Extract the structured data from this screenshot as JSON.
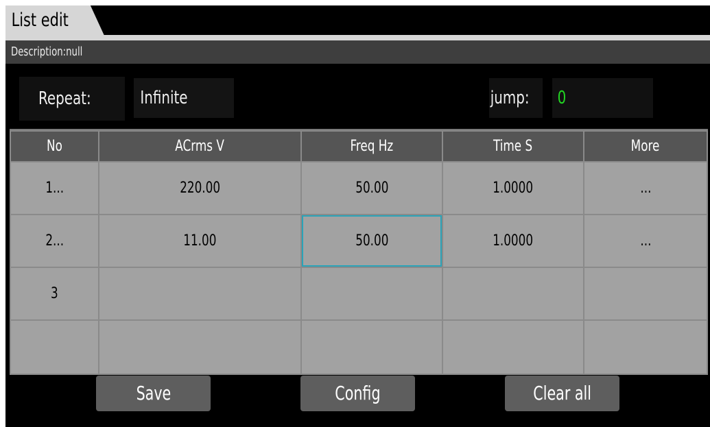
{
  "tab": {
    "title": "List edit"
  },
  "description": {
    "text": "Description:null"
  },
  "repeat": {
    "label": "Repeat:",
    "value": "Infinite"
  },
  "jump": {
    "label": "jump:",
    "value": "0"
  },
  "table": {
    "headers": [
      "No",
      "ACrms V",
      "Freq Hz",
      "Time S",
      "More"
    ],
    "rows": [
      [
        "1...",
        "220.00",
        "50.00",
        "1.0000",
        "..."
      ],
      [
        "2...",
        "11.00",
        "50.00",
        "1.0000",
        "..."
      ],
      [
        "3",
        "",
        "",
        "",
        ""
      ],
      [
        "",
        "",
        "",
        "",
        ""
      ]
    ],
    "selected_cell": {
      "row": 2,
      "column": "Freq Hz"
    }
  },
  "buttons": {
    "save": "Save",
    "config": "Config",
    "clear_all": "Clear all"
  },
  "colors": {
    "background": "#000000",
    "tab": "#d6d6d6",
    "header": "#555555",
    "cell": "#a2a2a2",
    "selection": "#2aa3b8",
    "jump_value": "#22d622",
    "button": "#5e5e5e"
  }
}
